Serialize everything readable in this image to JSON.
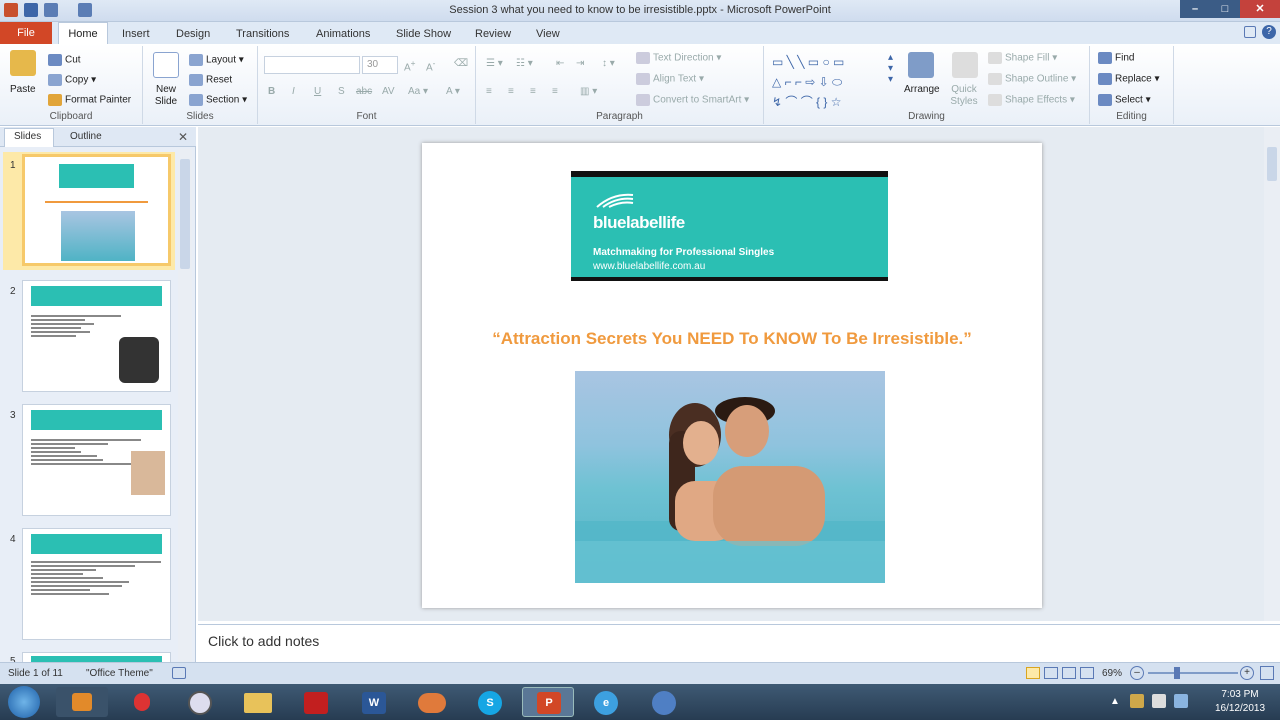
{
  "window": {
    "title": "Session 3 what you need to know to be irresistible.pptx - Microsoft PowerPoint"
  },
  "tabs": {
    "file": "File",
    "home": "Home",
    "insert": "Insert",
    "design": "Design",
    "transitions": "Transitions",
    "animations": "Animations",
    "slideshow": "Slide Show",
    "review": "Review",
    "view": "View"
  },
  "ribbon": {
    "clipboard": {
      "label": "Clipboard",
      "paste": "Paste",
      "cut": "Cut",
      "copy": "Copy",
      "format_painter": "Format Painter"
    },
    "slides": {
      "label": "Slides",
      "new_slide": "New Slide",
      "layout": "Layout",
      "reset": "Reset",
      "section": "Section"
    },
    "font": {
      "label": "Font",
      "size": "30"
    },
    "paragraph": {
      "label": "Paragraph",
      "text_direction": "Text Direction",
      "align_text": "Align Text",
      "convert_smartart": "Convert to SmartArt"
    },
    "drawing": {
      "label": "Drawing",
      "arrange": "Arrange",
      "quick_styles": "Quick Styles",
      "shape_fill": "Shape Fill",
      "shape_outline": "Shape Outline",
      "shape_effects": "Shape Effects"
    },
    "editing": {
      "label": "Editing",
      "find": "Find",
      "replace": "Replace",
      "select": "Select"
    }
  },
  "pane": {
    "slides_tab": "Slides",
    "outline_tab": "Outline",
    "thumb_numbers": [
      "1",
      "2",
      "3",
      "4",
      "5"
    ]
  },
  "slide": {
    "brand": "bluelabellife",
    "tagline": "Matchmaking for Professional Singles",
    "url": "www.bluelabellife.com.au",
    "title": "“Attraction Secrets You NEED To KNOW To Be Irresistible.”"
  },
  "notes": {
    "placeholder": "Click to add notes"
  },
  "status": {
    "slide_info": "Slide 1 of 11",
    "theme": "\"Office Theme\"",
    "zoom": "69%"
  },
  "clock": {
    "time": "7:03 PM",
    "date": "16/12/2013"
  },
  "colors": {
    "accent": "#2bbfb3",
    "title_orange": "#f09a3e",
    "file_tab": "#d24726"
  }
}
